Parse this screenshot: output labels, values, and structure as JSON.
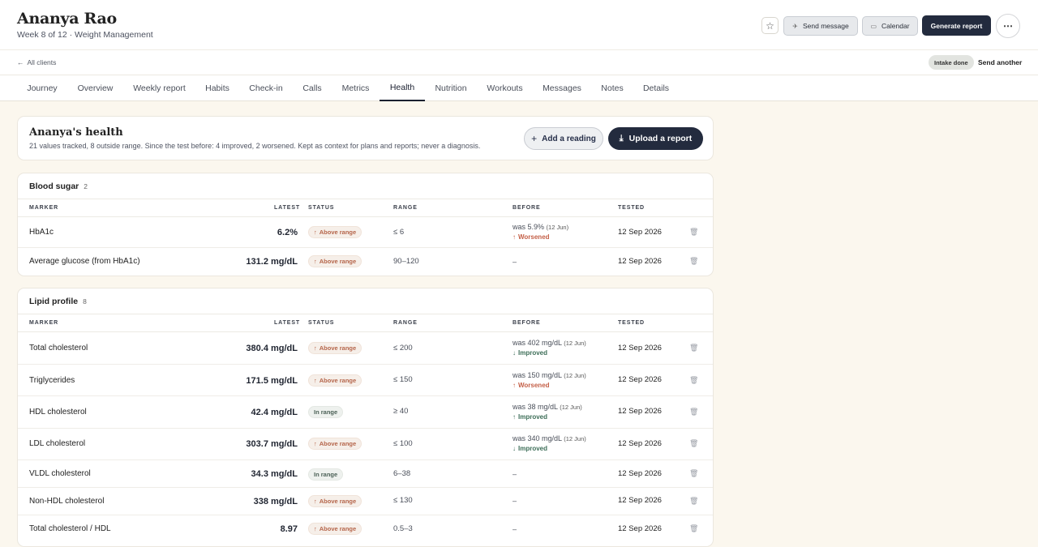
{
  "header": {
    "client_name": "Ananya Rao",
    "subtitle": "Week 8 of 12 · Weight Management",
    "send_message": "Send message",
    "calendar": "Calendar",
    "generate_report": "Generate report",
    "star_icon": "☆",
    "more_icon": "⋯",
    "send_icon": "✈",
    "calendar_icon": "▭"
  },
  "subbar": {
    "back_icon": "←",
    "back_label": "All clients",
    "intake_badge": "Intake done",
    "send_another": "Send another"
  },
  "tabs": [
    {
      "label": "Journey"
    },
    {
      "label": "Overview"
    },
    {
      "label": "Weekly report"
    },
    {
      "label": "Habits"
    },
    {
      "label": "Check-in"
    },
    {
      "label": "Calls"
    },
    {
      "label": "Metrics"
    },
    {
      "label": "Health",
      "active": true
    },
    {
      "label": "Nutrition"
    },
    {
      "label": "Workouts"
    },
    {
      "label": "Messages"
    },
    {
      "label": "Notes"
    },
    {
      "label": "Details"
    }
  ],
  "health": {
    "title": "Ananya's health",
    "description": "21 values tracked, 8 outside range. Since the test before: 4 improved, 2 worsened. Kept as context for plans and reports; never a diagnosis.",
    "add_reading": "Add a reading",
    "upload_report": "Upload a report",
    "add_icon": "+",
    "upload_icon": "⤓"
  },
  "columns": {
    "marker": "MARKER",
    "latest": "LATEST",
    "status": "STATUS",
    "range": "RANGE",
    "before": "BEFORE",
    "tested": "TESTED"
  },
  "icons": {
    "up_arrow": "↑",
    "down_arrow": "↓",
    "trash": "🗑"
  },
  "sections": [
    {
      "title": "Blood sugar",
      "count": "2",
      "rows": [
        {
          "marker": "HbA1c",
          "latest": "6.2%",
          "status": "Above range",
          "status_type": "above",
          "range": "≤ 6",
          "before_value": "was 5.9%",
          "before_date": "(12 Jun)",
          "trend": "Worsened",
          "trend_type": "worse",
          "tested": "12 Sep 2026"
        },
        {
          "marker": "Average glucose (from HbA1c)",
          "latest": "131.2 mg/dL",
          "status": "Above range",
          "status_type": "above",
          "range": "90–120",
          "before_value": "–",
          "before_date": "",
          "trend": "",
          "trend_type": "",
          "tested": "12 Sep 2026"
        }
      ]
    },
    {
      "title": "Lipid profile",
      "count": "8",
      "rows": [
        {
          "marker": "Total cholesterol",
          "latest": "380.4 mg/dL",
          "status": "Above range",
          "status_type": "above",
          "range": "≤ 200",
          "before_value": "was 402 mg/dL",
          "before_date": "(12 Jun)",
          "trend": "Improved",
          "trend_type": "better-down",
          "tested": "12 Sep 2026"
        },
        {
          "marker": "Triglycerides",
          "latest": "171.5 mg/dL",
          "status": "Above range",
          "status_type": "above",
          "range": "≤ 150",
          "before_value": "was 150 mg/dL",
          "before_date": "(12 Jun)",
          "trend": "Worsened",
          "trend_type": "worse",
          "tested": "12 Sep 2026"
        },
        {
          "marker": "HDL cholesterol",
          "latest": "42.4 mg/dL",
          "status": "In range",
          "status_type": "in",
          "range": "≥ 40",
          "before_value": "was 38 mg/dL",
          "before_date": "(12 Jun)",
          "trend": "Improved",
          "trend_type": "better-up",
          "tested": "12 Sep 2026"
        },
        {
          "marker": "LDL cholesterol",
          "latest": "303.7 mg/dL",
          "status": "Above range",
          "status_type": "above",
          "range": "≤ 100",
          "before_value": "was 340 mg/dL",
          "before_date": "(12 Jun)",
          "trend": "Improved",
          "trend_type": "better-down",
          "tested": "12 Sep 2026"
        },
        {
          "marker": "VLDL cholesterol",
          "latest": "34.3 mg/dL",
          "status": "In range",
          "status_type": "in",
          "range": "6–38",
          "before_value": "–",
          "before_date": "",
          "trend": "",
          "trend_type": "",
          "tested": "12 Sep 2026"
        },
        {
          "marker": "Non-HDL cholesterol",
          "latest": "338 mg/dL",
          "status": "Above range",
          "status_type": "above",
          "range": "≤ 130",
          "before_value": "–",
          "before_date": "",
          "trend": "",
          "trend_type": "",
          "tested": "12 Sep 2026"
        },
        {
          "marker": "Total cholesterol / HDL",
          "latest": "8.97",
          "status": "Above range",
          "status_type": "above",
          "range": "0.5–3",
          "before_value": "–",
          "before_date": "",
          "trend": "",
          "trend_type": "",
          "tested": "12 Sep 2026"
        }
      ]
    }
  ]
}
